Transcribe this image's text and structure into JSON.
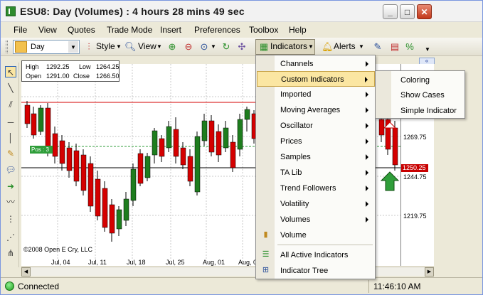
{
  "window": {
    "title": "ESU8: Day (Volumes) : 4 hours 28 mins 49 sec",
    "min_label": "_",
    "max_label": "□",
    "close_label": "✕"
  },
  "menubar": {
    "items": [
      "File",
      "View",
      "Quotes",
      "Trade Mode",
      "Insert",
      "Preferences",
      "Toolbox",
      "Help"
    ]
  },
  "toolbar": {
    "period_value": "Day",
    "style_label": "Style",
    "view_label": "View",
    "indicators_label": "Indicators",
    "alerts_label": "Alerts"
  },
  "ohlc": {
    "high_label": "High",
    "high_value": "1292.25",
    "low_label": "Low",
    "low_value": "1264.25",
    "open_label": "Open",
    "open_value": "1291.00",
    "close_label": "Close",
    "close_value": "1266.50"
  },
  "chart": {
    "position_tag": "Pos : 3",
    "copyright": "©2008 Open E Cry, LLC",
    "price_labels": [
      "1269.75",
      "1244.75",
      "1219.75"
    ],
    "last_price": "1250.25",
    "x_labels": [
      "Jul, 04",
      "Jul, 11",
      "Jul, 18",
      "Jul, 25",
      "Aug, 01",
      "Aug, 0"
    ],
    "colors": {
      "up": "#1e7d1e",
      "down": "#d40000",
      "resistance": "#d40000",
      "support": "#000000",
      "position": "#2f9e3a"
    }
  },
  "indicators_menu": {
    "items": [
      {
        "label": "Channels",
        "submenu": true
      },
      {
        "label": "Custom Indicators",
        "submenu": true,
        "highlighted": true
      },
      {
        "label": "Imported",
        "submenu": true
      },
      {
        "label": "Moving Averages",
        "submenu": true
      },
      {
        "label": "Oscillator",
        "submenu": true
      },
      {
        "label": "Prices",
        "submenu": true
      },
      {
        "label": "Samples",
        "submenu": true
      },
      {
        "label": "TA Lib",
        "submenu": true
      },
      {
        "label": "Trend Followers",
        "submenu": true
      },
      {
        "label": "Volatility",
        "submenu": true
      },
      {
        "label": "Volumes",
        "submenu": true
      },
      {
        "label": "Volume",
        "submenu": false,
        "icon": "volume-bars-icon"
      },
      {
        "label": "All Active Indicators",
        "submenu": false,
        "icon": "list-icon"
      },
      {
        "label": "Indicator Tree",
        "submenu": false,
        "icon": "tree-icon"
      }
    ]
  },
  "custom_indicators_submenu": {
    "items": [
      "Coloring",
      "Show Cases",
      "Simple Indicator"
    ]
  },
  "status": {
    "connection": "Connected",
    "time": "11:46:10 AM"
  }
}
